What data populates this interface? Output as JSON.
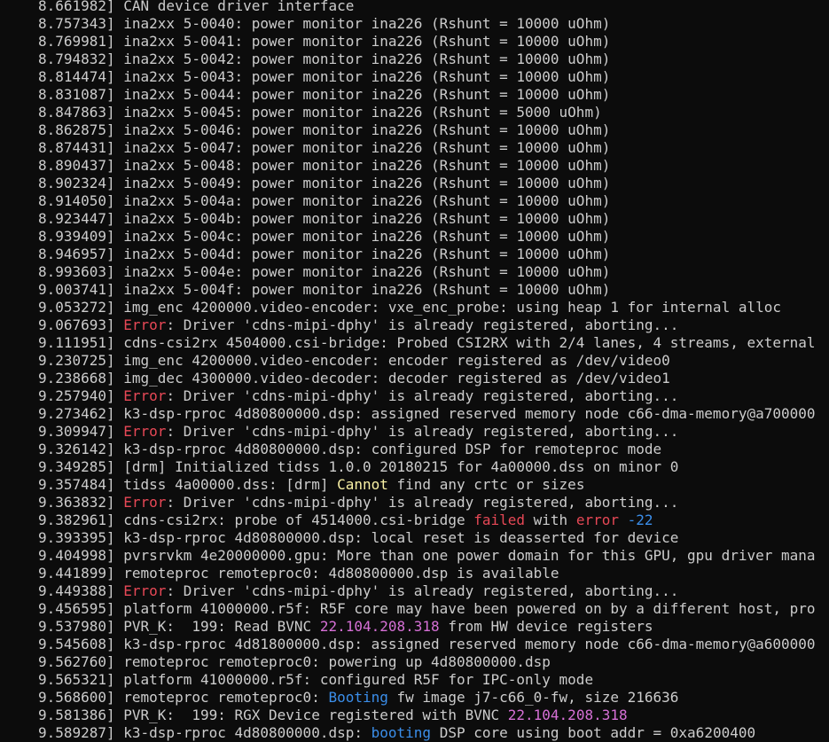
{
  "terminal": {
    "colors": {
      "background": "#0c0c0c",
      "text": "#cccccc",
      "error": "#e74856",
      "warn": "#f9f1a5",
      "blue": "#3b8eea",
      "magenta": "#d670d6"
    },
    "lines": [
      {
        "ts": "8.661982",
        "segs": [
          {
            "t": "CAN device driver interface",
            "c": "normal"
          }
        ]
      },
      {
        "ts": "8.757343",
        "segs": [
          {
            "t": "ina2xx 5-0040: power monitor ina226 (Rshunt = 10000 uOhm)",
            "c": "normal"
          }
        ]
      },
      {
        "ts": "8.769981",
        "segs": [
          {
            "t": "ina2xx 5-0041: power monitor ina226 (Rshunt = 10000 uOhm)",
            "c": "normal"
          }
        ]
      },
      {
        "ts": "8.794832",
        "segs": [
          {
            "t": "ina2xx 5-0042: power monitor ina226 (Rshunt = 10000 uOhm)",
            "c": "normal"
          }
        ]
      },
      {
        "ts": "8.814474",
        "segs": [
          {
            "t": "ina2xx 5-0043: power monitor ina226 (Rshunt = 10000 uOhm)",
            "c": "normal"
          }
        ]
      },
      {
        "ts": "8.831087",
        "segs": [
          {
            "t": "ina2xx 5-0044: power monitor ina226 (Rshunt = 10000 uOhm)",
            "c": "normal"
          }
        ]
      },
      {
        "ts": "8.847863",
        "segs": [
          {
            "t": "ina2xx 5-0045: power monitor ina226 (Rshunt = 5000 uOhm)",
            "c": "normal"
          }
        ]
      },
      {
        "ts": "8.862875",
        "segs": [
          {
            "t": "ina2xx 5-0046: power monitor ina226 (Rshunt = 10000 uOhm)",
            "c": "normal"
          }
        ]
      },
      {
        "ts": "8.874431",
        "segs": [
          {
            "t": "ina2xx 5-0047: power monitor ina226 (Rshunt = 10000 uOhm)",
            "c": "normal"
          }
        ]
      },
      {
        "ts": "8.890437",
        "segs": [
          {
            "t": "ina2xx 5-0048: power monitor ina226 (Rshunt = 10000 uOhm)",
            "c": "normal"
          }
        ]
      },
      {
        "ts": "8.902324",
        "segs": [
          {
            "t": "ina2xx 5-0049: power monitor ina226 (Rshunt = 10000 uOhm)",
            "c": "normal"
          }
        ]
      },
      {
        "ts": "8.914050",
        "segs": [
          {
            "t": "ina2xx 5-004a: power monitor ina226 (Rshunt = 10000 uOhm)",
            "c": "normal"
          }
        ]
      },
      {
        "ts": "8.923447",
        "segs": [
          {
            "t": "ina2xx 5-004b: power monitor ina226 (Rshunt = 10000 uOhm)",
            "c": "normal"
          }
        ]
      },
      {
        "ts": "8.939409",
        "segs": [
          {
            "t": "ina2xx 5-004c: power monitor ina226 (Rshunt = 10000 uOhm)",
            "c": "normal"
          }
        ]
      },
      {
        "ts": "8.946957",
        "segs": [
          {
            "t": "ina2xx 5-004d: power monitor ina226 (Rshunt = 10000 uOhm)",
            "c": "normal"
          }
        ]
      },
      {
        "ts": "8.993603",
        "segs": [
          {
            "t": "ina2xx 5-004e: power monitor ina226 (Rshunt = 10000 uOhm)",
            "c": "normal"
          }
        ]
      },
      {
        "ts": "9.003741",
        "segs": [
          {
            "t": "ina2xx 5-004f: power monitor ina226 (Rshunt = 10000 uOhm)",
            "c": "normal"
          }
        ]
      },
      {
        "ts": "9.053272",
        "segs": [
          {
            "t": "img_enc 4200000.video-encoder: vxe_enc_probe: using heap 1 for internal alloc",
            "c": "normal"
          }
        ]
      },
      {
        "ts": "9.067693",
        "segs": [
          {
            "t": "Error",
            "c": "error"
          },
          {
            "t": ": Driver 'cdns-mipi-dphy' is already registered, aborting...",
            "c": "normal"
          }
        ]
      },
      {
        "ts": "9.111951",
        "segs": [
          {
            "t": "cdns-csi2rx 4504000.csi-bridge: Probed CSI2RX with 2/4 lanes, 4 streams, external",
            "c": "normal"
          }
        ]
      },
      {
        "ts": "9.230725",
        "segs": [
          {
            "t": "img_enc 4200000.video-encoder: encoder registered as /dev/video0",
            "c": "normal"
          }
        ]
      },
      {
        "ts": "9.238668",
        "segs": [
          {
            "t": "img_dec 4300000.video-decoder: decoder registered as /dev/video1",
            "c": "normal"
          }
        ]
      },
      {
        "ts": "9.257940",
        "segs": [
          {
            "t": "Error",
            "c": "error"
          },
          {
            "t": ": Driver 'cdns-mipi-dphy' is already registered, aborting...",
            "c": "normal"
          }
        ]
      },
      {
        "ts": "9.273462",
        "segs": [
          {
            "t": "k3-dsp-rproc 4d80800000.dsp: assigned reserved memory node c66-dma-memory@a700000",
            "c": "normal"
          }
        ]
      },
      {
        "ts": "9.309947",
        "segs": [
          {
            "t": "Error",
            "c": "error"
          },
          {
            "t": ": Driver 'cdns-mipi-dphy' is already registered, aborting...",
            "c": "normal"
          }
        ]
      },
      {
        "ts": "9.326142",
        "segs": [
          {
            "t": "k3-dsp-rproc 4d80800000.dsp: configured DSP for remoteproc mode",
            "c": "normal"
          }
        ]
      },
      {
        "ts": "9.349285",
        "segs": [
          {
            "t": "[drm] Initialized tidss 1.0.0 20180215 for 4a00000.dss on minor 0",
            "c": "normal"
          }
        ]
      },
      {
        "ts": "9.357484",
        "segs": [
          {
            "t": "tidss 4a00000.dss: [drm] ",
            "c": "normal"
          },
          {
            "t": "Cannot",
            "c": "warn"
          },
          {
            "t": " find any crtc or sizes",
            "c": "normal"
          }
        ]
      },
      {
        "ts": "9.363832",
        "segs": [
          {
            "t": "Error",
            "c": "error"
          },
          {
            "t": ": Driver 'cdns-mipi-dphy' is already registered, aborting...",
            "c": "normal"
          }
        ]
      },
      {
        "ts": "9.382961",
        "segs": [
          {
            "t": "cdns-csi2rx: probe of 4514000.csi-bridge ",
            "c": "normal"
          },
          {
            "t": "failed",
            "c": "error"
          },
          {
            "t": " with ",
            "c": "normal"
          },
          {
            "t": "error",
            "c": "error"
          },
          {
            "t": " ",
            "c": "normal"
          },
          {
            "t": "-22",
            "c": "blue"
          }
        ]
      },
      {
        "ts": "9.393395",
        "segs": [
          {
            "t": "k3-dsp-rproc 4d80800000.dsp: local reset is deasserted for device",
            "c": "normal"
          }
        ]
      },
      {
        "ts": "9.404998",
        "segs": [
          {
            "t": "pvrsrvkm 4e20000000.gpu: More than one power domain for this GPU, gpu driver mana",
            "c": "normal"
          }
        ]
      },
      {
        "ts": "9.441899",
        "segs": [
          {
            "t": "remoteproc remoteproc0: 4d80800000.dsp is available",
            "c": "normal"
          }
        ]
      },
      {
        "ts": "9.449388",
        "segs": [
          {
            "t": "Error",
            "c": "error"
          },
          {
            "t": ": Driver 'cdns-mipi-dphy' is already registered, aborting...",
            "c": "normal"
          }
        ]
      },
      {
        "ts": "9.456595",
        "segs": [
          {
            "t": "platform 41000000.r5f: R5F core may have been powered on by a different host, pro",
            "c": "normal"
          }
        ]
      },
      {
        "ts": "9.537980",
        "segs": [
          {
            "t": "PVR_K:  199: Read BVNC ",
            "c": "normal"
          },
          {
            "t": "22.104.208.318",
            "c": "magenta"
          },
          {
            "t": " from HW device registers",
            "c": "normal"
          }
        ]
      },
      {
        "ts": "9.545608",
        "segs": [
          {
            "t": "k3-dsp-rproc 4d81800000.dsp: assigned reserved memory node c66-dma-memory@a600000",
            "c": "normal"
          }
        ]
      },
      {
        "ts": "9.562760",
        "segs": [
          {
            "t": "remoteproc remoteproc0: powering up 4d80800000.dsp",
            "c": "normal"
          }
        ]
      },
      {
        "ts": "9.565321",
        "segs": [
          {
            "t": "platform 41000000.r5f: configured R5F for IPC-only mode",
            "c": "normal"
          }
        ]
      },
      {
        "ts": "9.568600",
        "segs": [
          {
            "t": "remoteproc remoteproc0: ",
            "c": "normal"
          },
          {
            "t": "Booting",
            "c": "blue"
          },
          {
            "t": " fw image j7-c66_0-fw, size 216636",
            "c": "normal"
          }
        ]
      },
      {
        "ts": "9.581386",
        "segs": [
          {
            "t": "PVR_K:  199: RGX Device registered with BVNC ",
            "c": "normal"
          },
          {
            "t": "22.104.208.318",
            "c": "magenta"
          }
        ]
      },
      {
        "ts": "9.589287",
        "segs": [
          {
            "t": "k3-dsp-rproc 4d80800000.dsp: ",
            "c": "normal"
          },
          {
            "t": "booting",
            "c": "blue"
          },
          {
            "t": " DSP core using boot addr = 0xa6200400",
            "c": "normal"
          }
        ]
      }
    ]
  }
}
